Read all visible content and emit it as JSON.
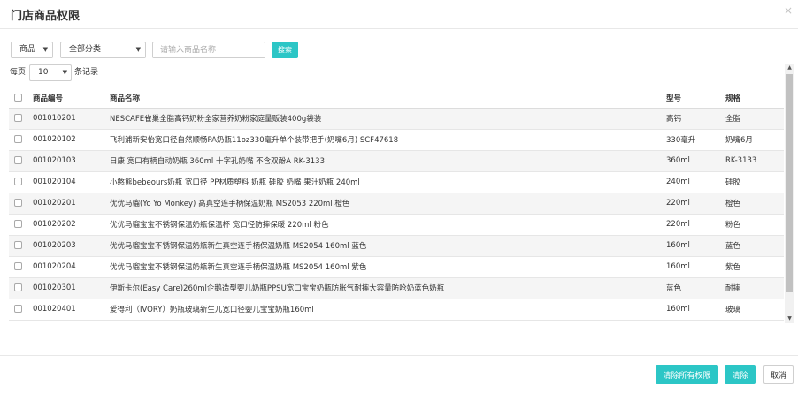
{
  "dialog": {
    "title": "门店商品权限",
    "close_label": "×"
  },
  "filters": {
    "type_select": "商品",
    "category_select": "全部分类",
    "search_placeholder": "请输入商品名称",
    "search_button": "搜索"
  },
  "page_size": {
    "prefix": "每页",
    "value": "10",
    "suffix": "条记录"
  },
  "table": {
    "headers": {
      "code": "商品编号",
      "name": "商品名称",
      "model": "型号",
      "spec": "规格"
    },
    "rows": [
      {
        "code": "001010201",
        "name": "NESCAFE雀巢全脂高钙奶粉全家营养奶粉家庭量贩装400g袋装",
        "model": "高钙",
        "spec": "全脂"
      },
      {
        "code": "001020102",
        "name": "飞利浦新安怡宽口径自然顺畅PA奶瓶11oz330毫升单个装带把手(奶嘴6月) SCF47618",
        "model": "330毫升",
        "spec": "奶嘴6月"
      },
      {
        "code": "001020103",
        "name": "日康 宽口有柄自动奶瓶 360ml 十字孔奶嘴 不含双酚A RK-3133",
        "model": "360ml",
        "spec": "RK-3133"
      },
      {
        "code": "001020104",
        "name": "小憨熊bebeours奶瓶 宽口径 PP材质塑料 奶瓶 硅胶 奶嘴 果汁奶瓶 240ml",
        "model": "240ml",
        "spec": "硅胶"
      },
      {
        "code": "001020201",
        "name": "优优马骝(Yo Yo Monkey) 高真空连手柄保温奶瓶 MS2053 220ml 橙色",
        "model": "220ml",
        "spec": "橙色"
      },
      {
        "code": "001020202",
        "name": "优优马骝宝宝不锈钢保温奶瓶保温杯 宽口径防摔保暖 220ml 粉色",
        "model": "220ml",
        "spec": "粉色"
      },
      {
        "code": "001020203",
        "name": "优优马骝宝宝不锈钢保温奶瓶新生真空连手柄保温奶瓶 MS2054 160ml 蓝色",
        "model": "160ml",
        "spec": "蓝色"
      },
      {
        "code": "001020204",
        "name": "优优马骝宝宝不锈钢保温奶瓶新生真空连手柄保温奶瓶 MS2054 160ml 紫色",
        "model": "160ml",
        "spec": "紫色"
      },
      {
        "code": "001020301",
        "name": "伊斯卡尔(Easy Care)260ml企鹅造型婴儿奶瓶PPSU宽口宝宝奶瓶防胀气耐摔大容量防呛奶蓝色奶瓶",
        "model": "蓝色",
        "spec": "耐摔"
      },
      {
        "code": "001020401",
        "name": "爱得利（IVORY）奶瓶玻璃新生儿宽口径婴儿宝宝奶瓶160ml",
        "model": "160ml",
        "spec": "玻璃"
      }
    ]
  },
  "footer": {
    "clear_all_label": "清除所有权限",
    "clear_label": "清除",
    "cancel_label": "取消"
  },
  "colors": {
    "accent": "#2cc6c6"
  }
}
